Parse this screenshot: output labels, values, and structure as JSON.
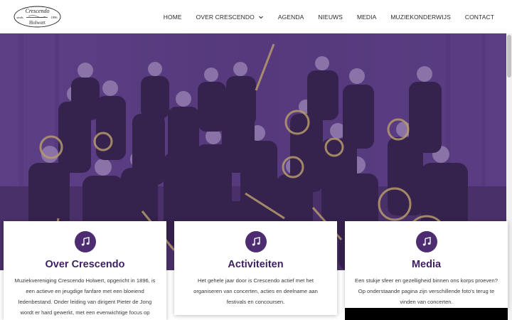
{
  "header": {
    "logo": {
      "line1": "Crescendo",
      "left": "sinds",
      "right": "1896",
      "line2": "Holwert"
    },
    "nav": [
      {
        "label": "HOME"
      },
      {
        "label": "OVER CRESCENDO",
        "has_dropdown": true
      },
      {
        "label": "AGENDA"
      },
      {
        "label": "NIEUWS"
      },
      {
        "label": "MEDIA"
      },
      {
        "label": "MUZIEKONDERWIJS"
      },
      {
        "label": "CONTACT"
      }
    ]
  },
  "hero": {
    "overlay_color": "#5b3c83"
  },
  "cards": [
    {
      "icon": "music-note-icon",
      "title": "Over Crescendo",
      "text": "Muziekvereniging Crescendo Holwert, opgericht in 1896, is een actieve en jeugdige fanfare met een bloeiend ledenbestand. Onder leiding van dirigent Pieter de Jong wordt er hard gewerkt, met een evenwichtige focus op muzikale vooruitgang en een gezellige sfeer. In een"
    },
    {
      "icon": "music-note-icon",
      "title": "Activiteiten",
      "text": "Het gehele jaar door is Crescendo actief met het organiseren van concerten, acties en deelname aan festivals en concoursen."
    },
    {
      "icon": "music-note-icon",
      "title": "Media",
      "text": "Een stukje sfeer en gezelligheid binnen ons korps proeven? Op onderstaande pagina zijn verschillende foto's terug te vinden van concerten."
    }
  ],
  "colors": {
    "accent": "#4d2c72",
    "title": "#3e1f62"
  }
}
